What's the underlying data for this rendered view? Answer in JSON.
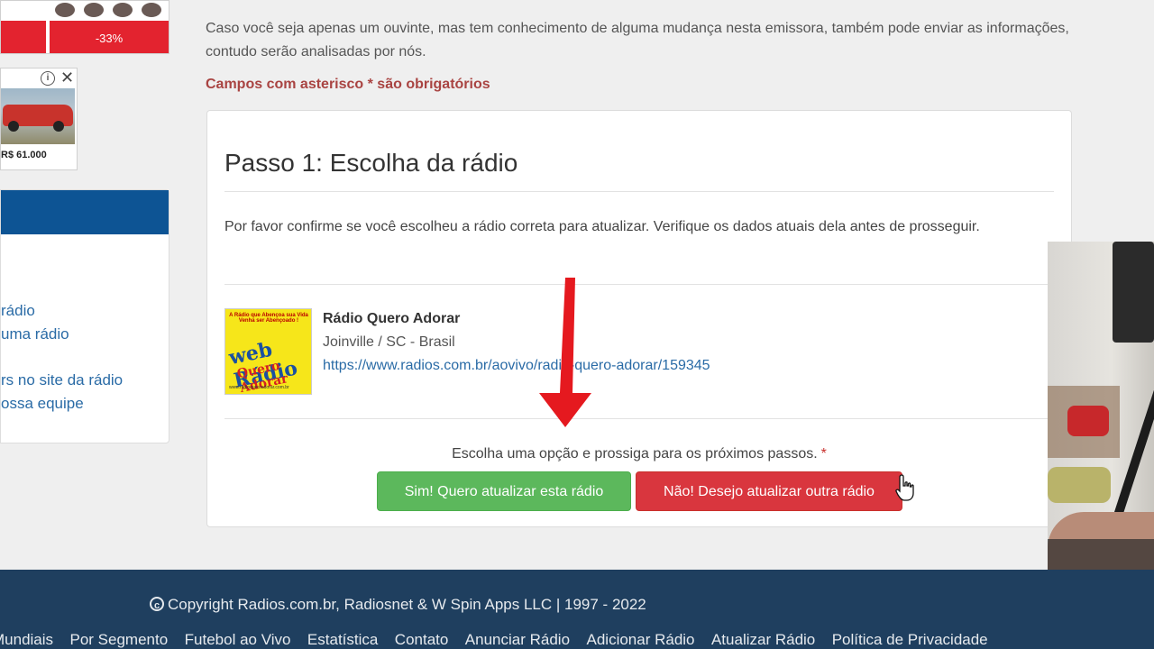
{
  "sidebar": {
    "ad_top": {
      "discount": "-33%"
    },
    "ad_car": {
      "price": "R$ 61.000"
    },
    "panel": {
      "links": [
        "rádio",
        "uma rádio",
        "rs no site da rádio",
        "ossa equipe"
      ]
    }
  },
  "main": {
    "intro": "Caso você seja apenas um ouvinte, mas tem conhecimento de alguma mudança nesta emissora, também pode enviar as informações, contudo serão analisadas por nós.",
    "required_note": "Campos com asterisco * são obrigatórios",
    "step_title": "Passo 1: Escolha da rádio",
    "step_desc": "Por favor confirme se você escolheu a rádio correta para atualizar. Verifique os dados atuais dela antes de prosseguir.",
    "radio": {
      "logo_top": "A Rádio que Abençoa sua Vida Venha ser Abençoado !",
      "logo_word1": "web Rádio",
      "logo_word2": "Quero Adorar",
      "logo_url": "www.radioqueroadorar.com.br",
      "name": "Rádio Quero Adorar",
      "location": "Joinville / SC - Brasil",
      "url": "https://www.radios.com.br/aovivo/radio-quero-adorar/159345"
    },
    "choose_text": "Escolha uma opção e prossiga para os próximos passos.",
    "required_star": "*",
    "btn_yes": "Sim! Quero atualizar esta rádio",
    "btn_no": "Não! Desejo atualizar outra rádio"
  },
  "footer": {
    "copyright": "Copyright Radios.com.br, Radiosnet & W Spin Apps LLC | 1997 - 2022",
    "links": [
      "Mundiais",
      "Por Segmento",
      "Futebol ao Vivo",
      "Estatística",
      "Contato",
      "Anunciar Rádio",
      "Adicionar Rádio",
      "Atualizar Rádio",
      "Política de Privacidade"
    ]
  },
  "colors": {
    "primary_blue": "#0d5494",
    "footer_bg": "#1f3f5f",
    "success": "#5cb85c",
    "danger": "#d9363e",
    "required_red": "#a94442",
    "annotation_arrow": "#e5191f"
  },
  "icons": [
    "info-icon",
    "close-icon",
    "copyright-icon",
    "hand-cursor-icon",
    "arrow-annotation"
  ]
}
